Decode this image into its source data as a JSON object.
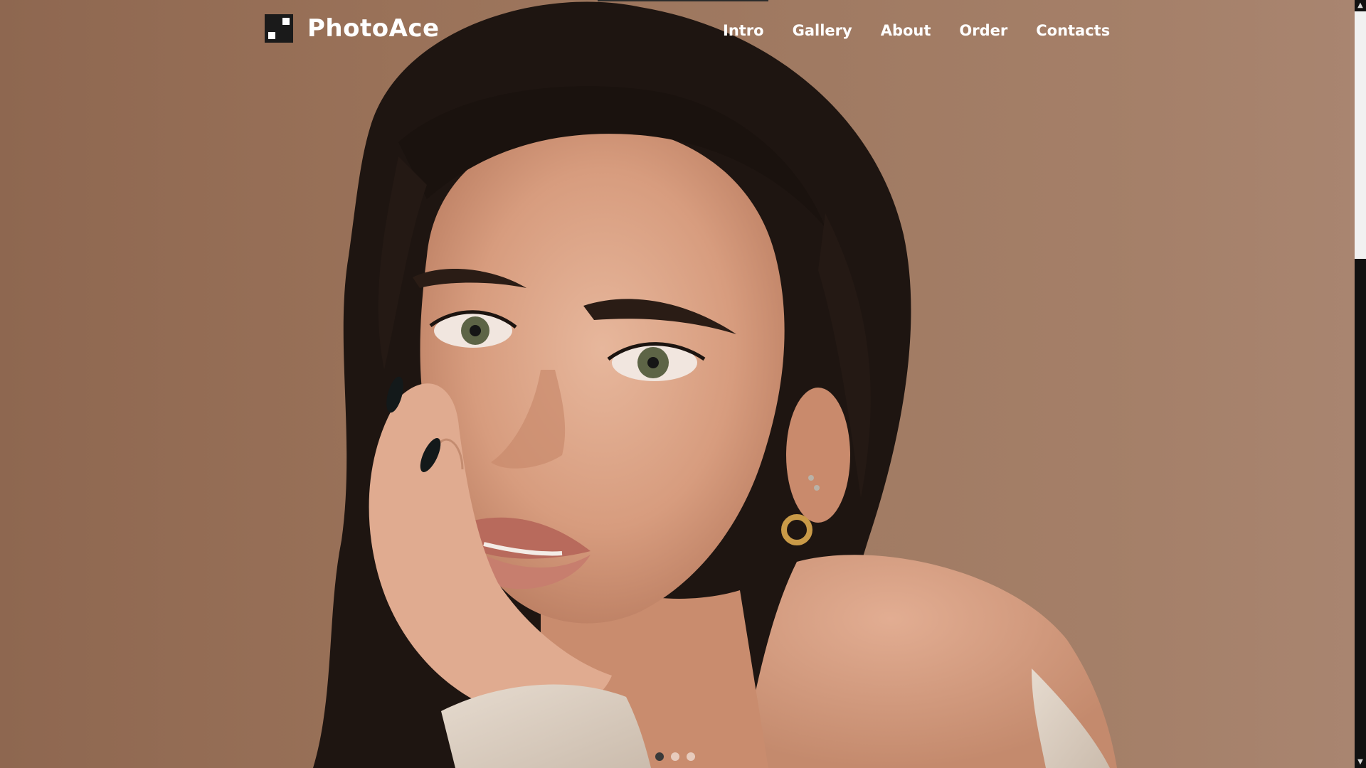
{
  "brand": {
    "name": "PhotoAce",
    "logo_icon": "pixel-logo-icon"
  },
  "nav": {
    "items": [
      {
        "label": "Intro"
      },
      {
        "label": "Gallery"
      },
      {
        "label": "About"
      },
      {
        "label": "Order"
      },
      {
        "label": "Contacts"
      }
    ]
  },
  "hero": {
    "image_subject": "portrait photo of a woman resting her cheek on her hand against a brown background",
    "slide_count": 3,
    "active_slide": 1
  },
  "colors": {
    "background_brown": "#9a7259",
    "text_white": "#ffffff",
    "active_dot": "#3a3a3a"
  }
}
